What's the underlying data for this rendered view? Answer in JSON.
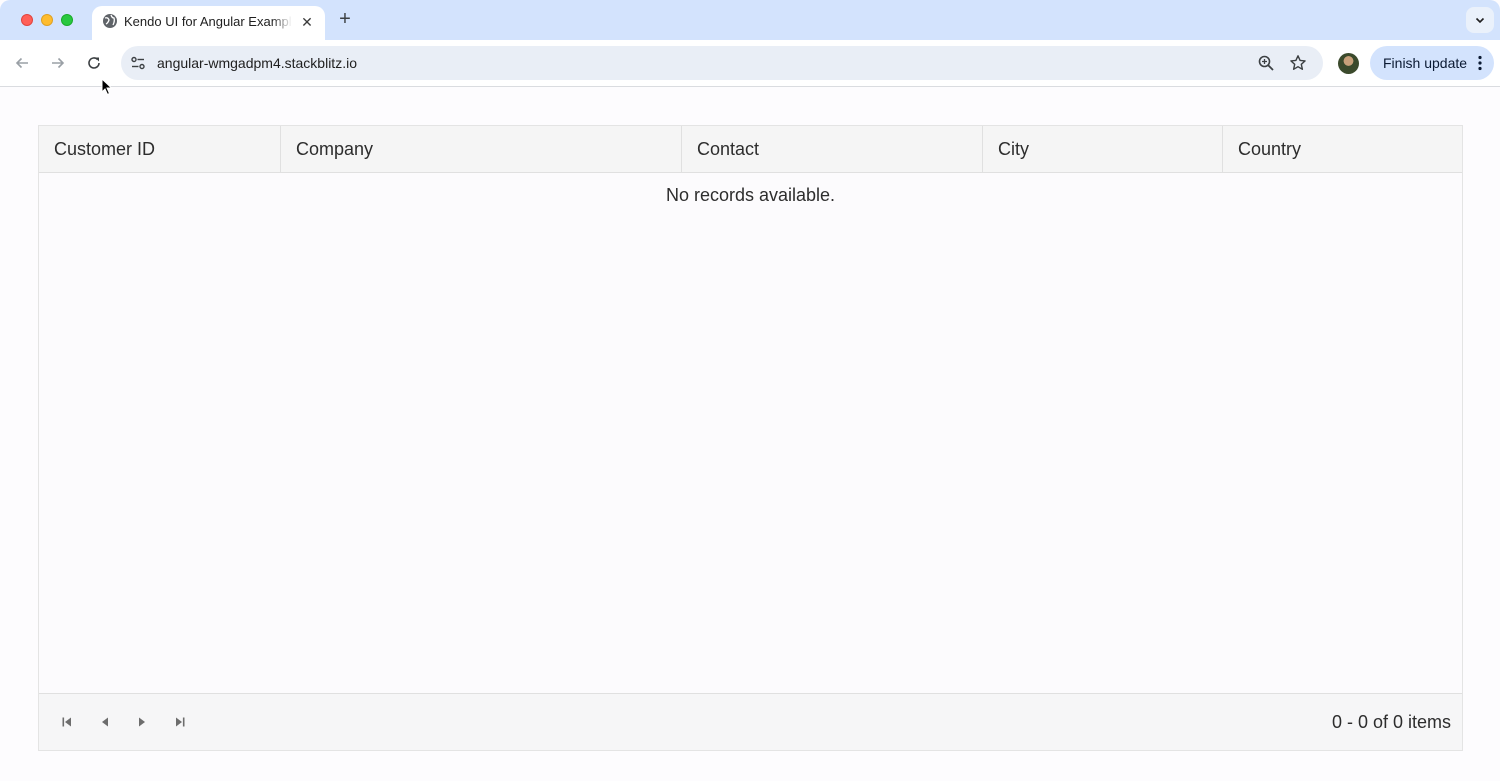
{
  "browser": {
    "tab": {
      "title": "Kendo UI for Angular Example",
      "icon": "globe-icon",
      "close_icon": "close-icon"
    },
    "new_tab_icon": "plus-icon",
    "tab_menu_icon": "chevron-down-icon",
    "toolbar": {
      "back_icon": "arrow-left-icon",
      "forward_icon": "arrow-right-icon",
      "reload_icon": "reload-icon",
      "site_info_icon": "tune-icon",
      "url": "angular-wmgadpm4.stackblitz.io",
      "zoom_icon": "zoom-icon",
      "bookmark_icon": "star-icon",
      "finish_update_label": "Finish update",
      "menu_icon": "more-vert-icon"
    },
    "colors": {
      "tabstrip": "#d3e3fd",
      "omnibox": "#e9eef6",
      "finish_update": "#d3e3fd"
    }
  },
  "grid": {
    "columns": [
      {
        "title": "Customer ID"
      },
      {
        "title": "Company"
      },
      {
        "title": "Contact"
      },
      {
        "title": "City"
      },
      {
        "title": "Country"
      }
    ],
    "no_records_text": "No records available.",
    "pager": {
      "first_icon": "page-first-icon",
      "prev_icon": "page-prev-icon",
      "next_icon": "page-next-icon",
      "last_icon": "page-last-icon",
      "info": "0 - 0 of 0 items"
    }
  }
}
